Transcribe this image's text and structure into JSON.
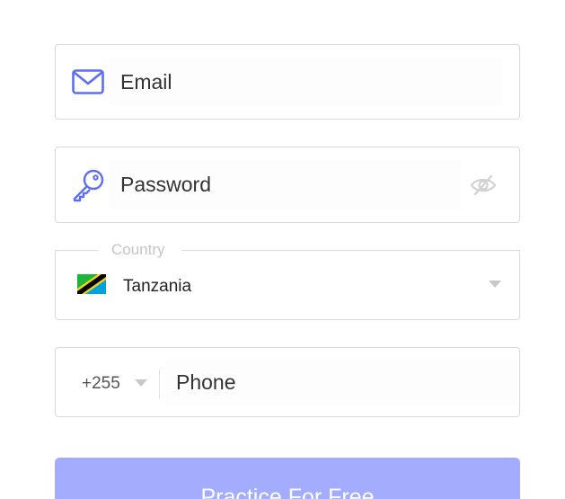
{
  "form": {
    "email": {
      "placeholder": "Email",
      "value": "",
      "icon": "envelope-icon"
    },
    "password": {
      "placeholder": "Password",
      "value": "",
      "icon": "key-icon",
      "toggle_icon": "eye-slash-icon"
    },
    "country": {
      "label": "Country",
      "value": "Tanzania",
      "flag_icon": "tanzania-flag-icon"
    },
    "phone": {
      "dial_code": "+255",
      "placeholder": "Phone",
      "value": ""
    },
    "submit_label": "Practice For Free"
  },
  "colors": {
    "accent": "#5b6ef5",
    "button": "#a4acfe",
    "border": "#d9d9d9",
    "muted": "#c4c4c4"
  }
}
